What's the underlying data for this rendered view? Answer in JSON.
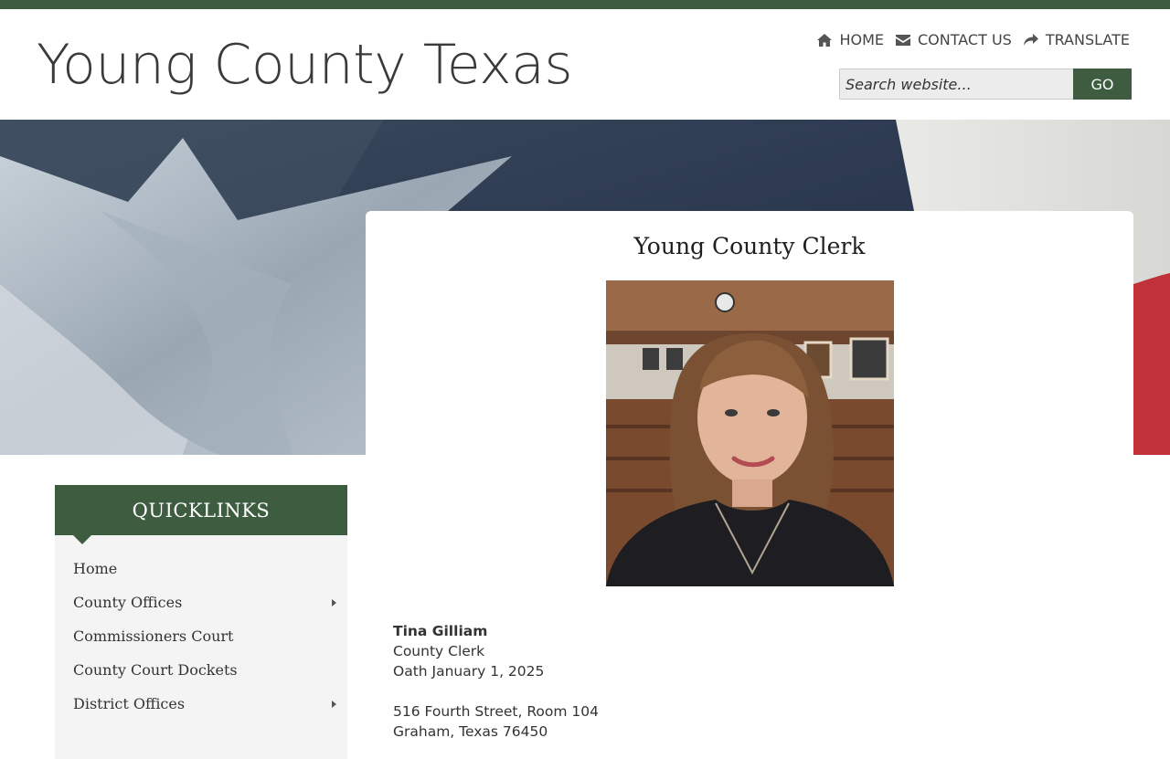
{
  "header": {
    "site_title": "Young County Texas",
    "nav": [
      {
        "label": "HOME",
        "icon": "home-icon"
      },
      {
        "label": "CONTACT US",
        "icon": "envelope-icon"
      },
      {
        "label": "TRANSLATE",
        "icon": "share-arrow-icon"
      }
    ],
    "search": {
      "placeholder": "Search website...",
      "value": "",
      "button_label": "GO"
    }
  },
  "colors": {
    "brand_green": "#3d5c40",
    "sidebar_bg": "#f4f4f4"
  },
  "hero": {
    "image": "texas-flag-background"
  },
  "main": {
    "title": "Young County Clerk",
    "portrait": "county-clerk-portrait",
    "contact": {
      "name": "Tina Gilliam",
      "position": "County Clerk",
      "oath": "Oath January 1, 2025",
      "address_line1": "516 Fourth Street, Room 104",
      "address_line2": "Graham, Texas 76450"
    }
  },
  "sidebar": {
    "title": "QUICKLINKS",
    "items": [
      {
        "label": "Home",
        "has_submenu": false
      },
      {
        "label": "County Offices",
        "has_submenu": true
      },
      {
        "label": "Commissioners Court",
        "has_submenu": false
      },
      {
        "label": "County Court Dockets",
        "has_submenu": false
      },
      {
        "label": "District Offices",
        "has_submenu": true
      }
    ]
  }
}
